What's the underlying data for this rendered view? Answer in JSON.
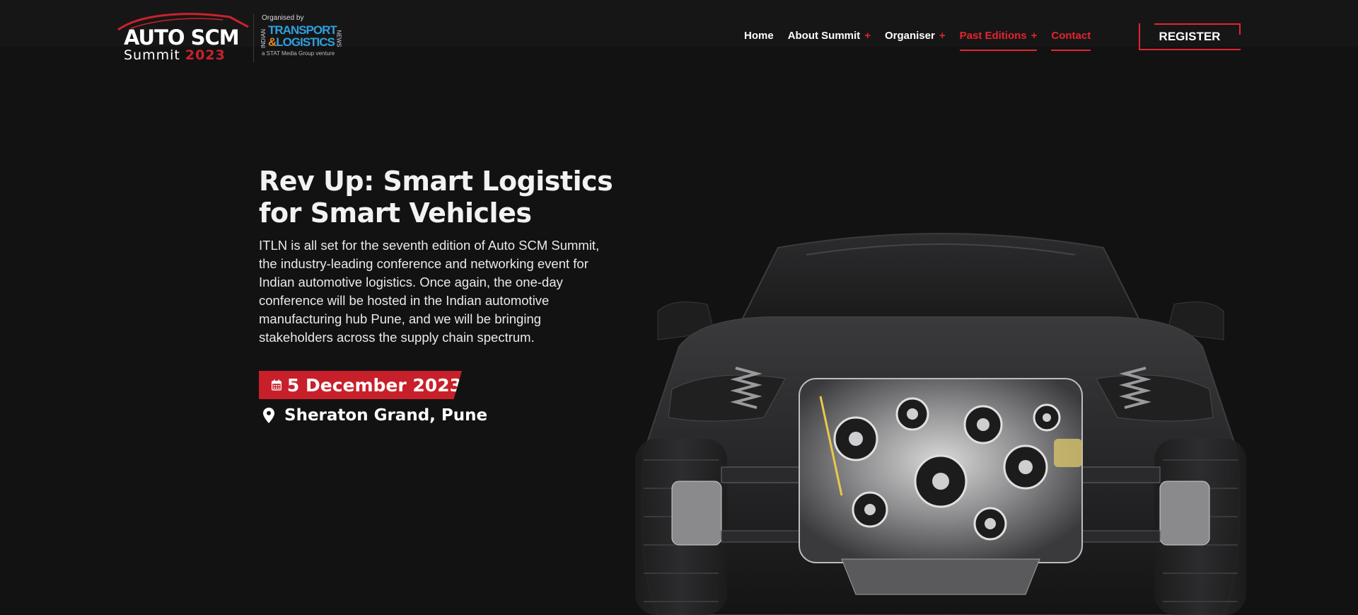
{
  "logo": {
    "line1": "AUTO SCM",
    "summit": "Summit",
    "year": "2023",
    "organised_by": "Organised by",
    "org_indian": "INDIAN",
    "org_transport": "TRANSPORT",
    "org_amp": "&",
    "org_logistics": "LOGISTICS",
    "org_news": "NEWS",
    "org_venture": "a STAT Media Group venture"
  },
  "nav": {
    "items": [
      {
        "label": "Home",
        "has_submenu": false,
        "active": false
      },
      {
        "label": "About Summit",
        "has_submenu": true,
        "active": false
      },
      {
        "label": "Organiser",
        "has_submenu": true,
        "active": false
      },
      {
        "label": "Past Editions",
        "has_submenu": true,
        "active": true
      },
      {
        "label": "Contact",
        "has_submenu": false,
        "active": true
      }
    ],
    "submenu_symbol": "+",
    "register_label": "REGISTER"
  },
  "hero": {
    "title": "Rev Up: Smart Logistics for Smart Vehicles",
    "description": "ITLN is all set for the seventh edition of Auto SCM Summit, the industry-leading conference and networking event for Indian automotive logistics. Once again, the one-day conference will be hosted in the Indian automotive manufacturing hub Pune, and we will be bringing stakeholders across the supply chain spectrum.",
    "date": "5 December 2023",
    "venue": "Sheraton Grand, Pune"
  },
  "icons": {
    "date": "calendar-icon",
    "venue": "map-pin-icon"
  },
  "colors": {
    "background": "#121213",
    "accent": "#e5232f",
    "badge": "#c8202a",
    "org_blue": "#2fa0dd",
    "org_orange": "#e48a1f"
  }
}
